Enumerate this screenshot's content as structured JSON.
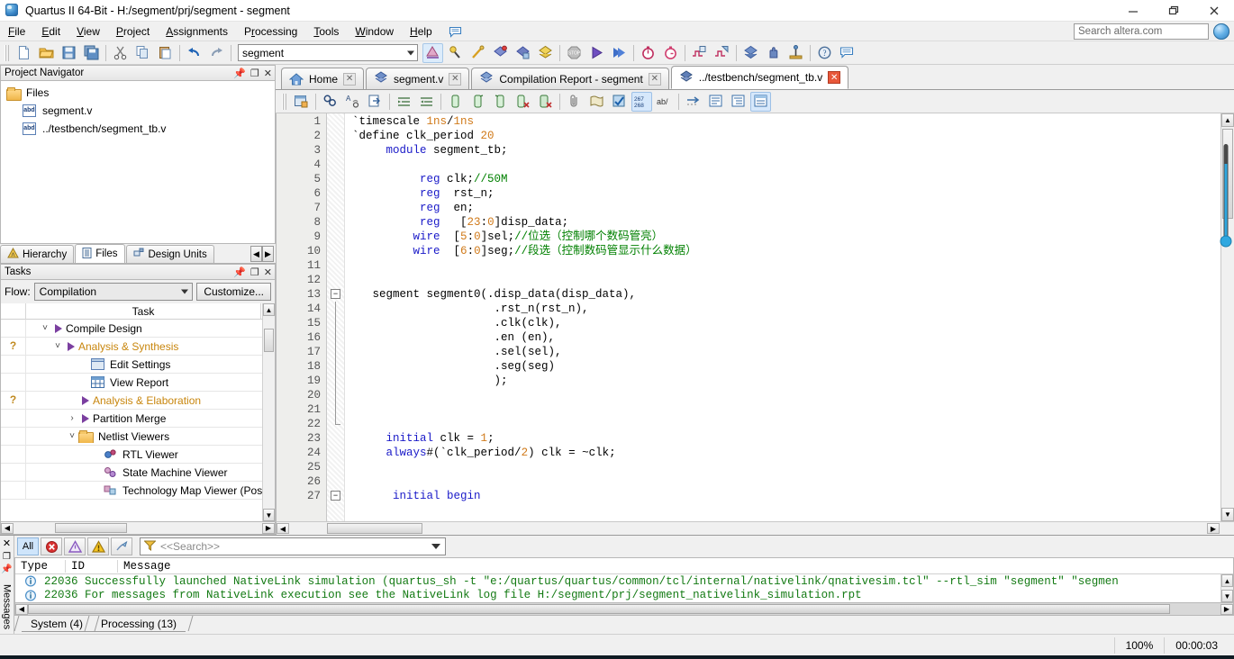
{
  "window": {
    "title": "Quartus II 64-Bit - H:/segment/prj/segment - segment",
    "icon": "quartus-icon",
    "minimize": "–",
    "maximize": "❐",
    "close": "✕"
  },
  "menubar": {
    "items": [
      {
        "label": "File",
        "mnemonic": "F"
      },
      {
        "label": "Edit",
        "mnemonic": "E"
      },
      {
        "label": "View",
        "mnemonic": "V"
      },
      {
        "label": "Project",
        "mnemonic": "P"
      },
      {
        "label": "Assignments",
        "mnemonic": "A"
      },
      {
        "label": "Processing",
        "mnemonic": "r"
      },
      {
        "label": "Tools",
        "mnemonic": "T"
      },
      {
        "label": "Window",
        "mnemonic": "W"
      },
      {
        "label": "Help",
        "mnemonic": "H"
      }
    ],
    "flag_icon": "message-flag-icon",
    "search": {
      "placeholder": "Search altera.com",
      "value": ""
    },
    "globe_icon": "globe-icon"
  },
  "toolbar": {
    "project_combo_value": "segment",
    "buttons": [
      "new-file-icon",
      "open-file-icon",
      "save-file-icon",
      "save-all-icon",
      "cut-icon",
      "copy-icon",
      "paste-icon",
      "undo-icon",
      "redo-icon",
      "compilation-tool-icon",
      "analysis-synthesis-icon",
      "assembler-pin-icon",
      "start-compilation-icon",
      "start-analysis-icon",
      "programmer-icon",
      "stop-icon",
      "start-icon",
      "fast-forward-icon",
      "timing-analyzer-icon",
      "timing-analyzer-2-icon",
      "simulation-in-icon",
      "simulation-out-icon",
      "download-icon",
      "hand-icon",
      "pin-planner-icon",
      "help-icon",
      "messages-icon"
    ]
  },
  "project_navigator": {
    "title": "Project Navigator",
    "controls": {
      "pin": "pin-icon",
      "restore": "restore-icon",
      "close": "close-icon"
    },
    "root": {
      "label": "Files",
      "icon": "folder-icon"
    },
    "files": [
      {
        "label": "segment.v",
        "icon": "verilog-file-icon"
      },
      {
        "label": "../testbench/segment_tb.v",
        "icon": "verilog-file-icon"
      }
    ],
    "tabs": [
      {
        "label": "Hierarchy",
        "icon": "hierarchy-icon",
        "active": false
      },
      {
        "label": "Files",
        "icon": "files-icon",
        "active": true
      },
      {
        "label": "Design Units",
        "icon": "design-units-icon",
        "active": false
      }
    ],
    "tab_nav": {
      "left": "◀",
      "right": "▶"
    }
  },
  "tasks": {
    "title": "Tasks",
    "controls": {
      "pin": "pin-icon",
      "restore": "restore-icon",
      "close": "close-icon"
    },
    "flow_label": "Flow:",
    "flow_value": "Compilation",
    "customize_label": "Customize...",
    "column_header": "Task",
    "rows": [
      {
        "status": "",
        "indent": 1,
        "chevron": "v",
        "icon": "play-triangle-icon",
        "label": "Compile Design",
        "amber": false
      },
      {
        "status": "?",
        "indent": 2,
        "chevron": "v",
        "icon": "play-triangle-icon",
        "label": "Analysis & Synthesis",
        "amber": true
      },
      {
        "status": "",
        "indent": 4,
        "chevron": "",
        "icon": "edit-settings-icon",
        "label": "Edit Settings",
        "amber": false
      },
      {
        "status": "",
        "indent": 4,
        "chevron": "",
        "icon": "view-report-icon",
        "label": "View Report",
        "amber": false
      },
      {
        "status": "?",
        "indent": 3,
        "chevron": "",
        "icon": "play-triangle-icon",
        "label": "Analysis & Elaboration",
        "amber": true
      },
      {
        "status": "",
        "indent": 3,
        "chevron": ">",
        "icon": "play-triangle-icon",
        "label": "Partition Merge",
        "amber": false
      },
      {
        "status": "",
        "indent": 3,
        "chevron": "v",
        "icon": "folder-icon",
        "label": "Netlist Viewers",
        "amber": false
      },
      {
        "status": "",
        "indent": 4,
        "chevron": "",
        "icon": "rtl-viewer-icon",
        "label": "RTL Viewer",
        "amber": false
      },
      {
        "status": "",
        "indent": 4,
        "chevron": "",
        "icon": "state-machine-viewer-icon",
        "label": "State Machine Viewer",
        "amber": false
      },
      {
        "status": "",
        "indent": 4,
        "chevron": "",
        "icon": "technology-map-viewer-icon",
        "label": "Technology Map Viewer (Post-",
        "amber": false
      }
    ]
  },
  "editor": {
    "tabs": [
      {
        "label": "Home",
        "icon": "home-icon",
        "active": false,
        "close": "✕",
        "close_red": false
      },
      {
        "label": "segment.v",
        "icon": "verilog-doc-icon",
        "active": false,
        "close": "✕",
        "close_red": false
      },
      {
        "label": "Compilation Report - segment",
        "icon": "compilation-report-icon",
        "active": false,
        "close": "✕",
        "close_red": false
      },
      {
        "label": "../testbench/segment_tb.v",
        "icon": "verilog-doc-icon",
        "active": true,
        "close": "✕",
        "close_red": true
      }
    ],
    "toolbar_buttons": [
      "insert-template-icon",
      "find-icon",
      "find-replace-icon",
      "goto-line-icon",
      "increase-indent-icon",
      "decrease-indent-icon",
      "comment-icon",
      "uncomment-icon",
      "outdent-icon",
      "remove-comment-icon",
      "delete-comment-icon",
      "attach-icon",
      "text-icon",
      "check-syntax-icon",
      "line-numbers-icon",
      "toggle-wrap-icon",
      "insert-icon",
      "template-1-icon",
      "template-2-icon",
      "template-3-icon"
    ],
    "line_count_shown": 27,
    "lines": [
      {
        "n": 1,
        "fold": "",
        "tokens": [
          {
            "t": "`timescale ",
            "c": "p"
          },
          {
            "t": "1ns",
            "c": "n"
          },
          {
            "t": "/",
            "c": "p"
          },
          {
            "t": "1ns",
            "c": "n"
          }
        ]
      },
      {
        "n": 2,
        "fold": "",
        "tokens": [
          {
            "t": "`define clk_period ",
            "c": "p"
          },
          {
            "t": "20",
            "c": "n"
          }
        ]
      },
      {
        "n": 3,
        "fold": "",
        "tokens": [
          {
            "t": "     ",
            "c": "p"
          },
          {
            "t": "module",
            "c": "k"
          },
          {
            "t": " segment_tb;",
            "c": "p"
          }
        ]
      },
      {
        "n": 4,
        "fold": "",
        "tokens": []
      },
      {
        "n": 5,
        "fold": "",
        "tokens": [
          {
            "t": "          ",
            "c": "p"
          },
          {
            "t": "reg",
            "c": "k"
          },
          {
            "t": " clk;",
            "c": "p"
          },
          {
            "t": "//50M",
            "c": "c"
          }
        ]
      },
      {
        "n": 6,
        "fold": "",
        "tokens": [
          {
            "t": "          ",
            "c": "p"
          },
          {
            "t": "reg",
            "c": "k"
          },
          {
            "t": "  rst_n;",
            "c": "p"
          }
        ]
      },
      {
        "n": 7,
        "fold": "",
        "tokens": [
          {
            "t": "          ",
            "c": "p"
          },
          {
            "t": "reg",
            "c": "k"
          },
          {
            "t": "  en;",
            "c": "p"
          }
        ]
      },
      {
        "n": 8,
        "fold": "",
        "tokens": [
          {
            "t": "          ",
            "c": "p"
          },
          {
            "t": "reg",
            "c": "k"
          },
          {
            "t": "   [",
            "c": "p"
          },
          {
            "t": "23",
            "c": "n"
          },
          {
            "t": ":",
            "c": "p"
          },
          {
            "t": "0",
            "c": "n"
          },
          {
            "t": "]disp_data;",
            "c": "p"
          }
        ]
      },
      {
        "n": 9,
        "fold": "",
        "tokens": [
          {
            "t": "         ",
            "c": "p"
          },
          {
            "t": "wire",
            "c": "k"
          },
          {
            "t": "  [",
            "c": "p"
          },
          {
            "t": "5",
            "c": "n"
          },
          {
            "t": ":",
            "c": "p"
          },
          {
            "t": "0",
            "c": "n"
          },
          {
            "t": "]sel;",
            "c": "p"
          },
          {
            "t": "//位选（控制哪个数码管亮）",
            "c": "c"
          }
        ]
      },
      {
        "n": 10,
        "fold": "",
        "tokens": [
          {
            "t": "         ",
            "c": "p"
          },
          {
            "t": "wire",
            "c": "k"
          },
          {
            "t": "  [",
            "c": "p"
          },
          {
            "t": "6",
            "c": "n"
          },
          {
            "t": ":",
            "c": "p"
          },
          {
            "t": "0",
            "c": "n"
          },
          {
            "t": "]seg;",
            "c": "p"
          },
          {
            "t": "//段选（控制数码管显示什么数据）",
            "c": "c"
          }
        ]
      },
      {
        "n": 11,
        "fold": "",
        "tokens": []
      },
      {
        "n": 12,
        "fold": "",
        "tokens": []
      },
      {
        "n": 13,
        "fold": "open",
        "tokens": [
          {
            "t": "   segment segment0(.disp_data(disp_data),",
            "c": "p"
          }
        ]
      },
      {
        "n": 14,
        "fold": "bar",
        "tokens": [
          {
            "t": "                     .rst_n(rst_n),",
            "c": "p"
          }
        ]
      },
      {
        "n": 15,
        "fold": "bar",
        "tokens": [
          {
            "t": "                     .clk(clk),",
            "c": "p"
          }
        ]
      },
      {
        "n": 16,
        "fold": "bar",
        "tokens": [
          {
            "t": "                     .en (en),",
            "c": "p"
          }
        ]
      },
      {
        "n": 17,
        "fold": "bar",
        "tokens": [
          {
            "t": "                     .sel(sel),",
            "c": "p"
          }
        ]
      },
      {
        "n": 18,
        "fold": "bar",
        "tokens": [
          {
            "t": "                     .seg(seg)",
            "c": "p"
          }
        ]
      },
      {
        "n": 19,
        "fold": "bar",
        "tokens": [
          {
            "t": "                     );",
            "c": "p"
          }
        ]
      },
      {
        "n": 20,
        "fold": "bar",
        "tokens": []
      },
      {
        "n": 21,
        "fold": "bar",
        "tokens": []
      },
      {
        "n": 22,
        "fold": "end",
        "tokens": []
      },
      {
        "n": 23,
        "fold": "",
        "tokens": [
          {
            "t": "     ",
            "c": "p"
          },
          {
            "t": "initial",
            "c": "k"
          },
          {
            "t": " clk = ",
            "c": "p"
          },
          {
            "t": "1",
            "c": "n"
          },
          {
            "t": ";",
            "c": "p"
          }
        ]
      },
      {
        "n": 24,
        "fold": "",
        "tokens": [
          {
            "t": "     ",
            "c": "p"
          },
          {
            "t": "always",
            "c": "k"
          },
          {
            "t": "#(`clk_period/",
            "c": "p"
          },
          {
            "t": "2",
            "c": "n"
          },
          {
            "t": ") clk = ~clk;",
            "c": "p"
          }
        ]
      },
      {
        "n": 25,
        "fold": "",
        "tokens": []
      },
      {
        "n": 26,
        "fold": "",
        "tokens": []
      },
      {
        "n": 27,
        "fold": "open",
        "tokens": [
          {
            "t": "      ",
            "c": "p"
          },
          {
            "t": "initial begin",
            "c": "k"
          }
        ]
      }
    ]
  },
  "messages": {
    "side_label": "Messages",
    "filter_buttons": [
      {
        "label": "All",
        "name": "filter-all-button",
        "selected": true
      },
      {
        "label": "",
        "name": "filter-error-button",
        "selected": false
      },
      {
        "label": "",
        "name": "filter-critical-warning-button",
        "selected": false
      },
      {
        "label": "",
        "name": "filter-warning-button",
        "selected": false
      },
      {
        "label": "",
        "name": "filter-info-button",
        "selected": false
      }
    ],
    "search_placeholder": "<<Search>>",
    "search_icon": "funnel-icon",
    "columns": [
      "Type",
      "ID",
      "Message"
    ],
    "rows": [
      {
        "icon": "info-icon",
        "id": "22036",
        "text": "Successfully launched NativeLink simulation (quartus_sh -t \"e:/quartus/quartus/common/tcl/internal/nativelink/qnativesim.tcl\" --rtl_sim \"segment\" \"segmen"
      },
      {
        "icon": "info-icon",
        "id": "22036",
        "text": "For messages from NativeLink execution see the NativeLink log file H:/segment/prj/segment_nativelink_simulation.rpt"
      }
    ],
    "tabs": [
      {
        "label": "System (4)",
        "active": false
      },
      {
        "label": "Processing (13)",
        "active": true
      }
    ]
  },
  "statusbar": {
    "zoom": "100%",
    "elapsed": "00:00:03"
  },
  "colors": {
    "accent": "#3a86c8",
    "keyword": "#1919c8",
    "number": "#d07a1a",
    "comment": "#008000",
    "message_text": "#137a13",
    "task_amber": "#c8860d",
    "tab_close_red": "#e8583a"
  }
}
